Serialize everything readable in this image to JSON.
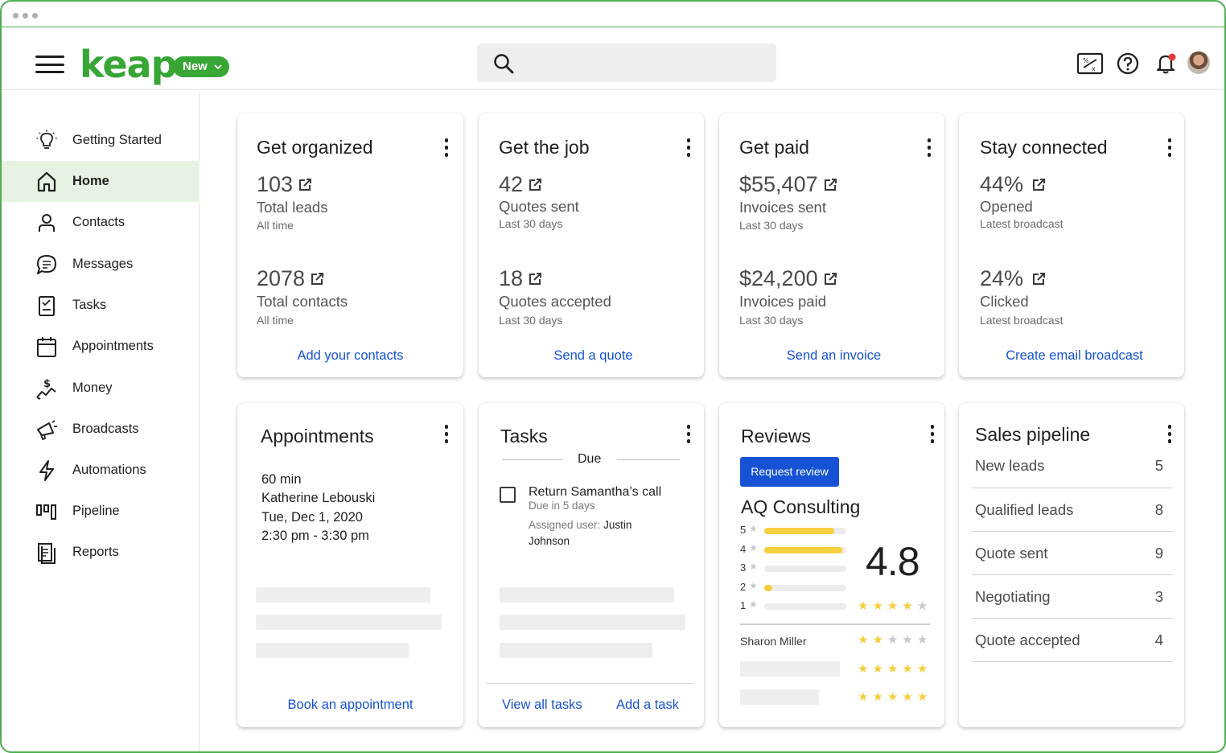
{
  "header": {
    "logo": "keap",
    "new_button": "New",
    "search_placeholder": ""
  },
  "sidebar": {
    "items": [
      {
        "label": "Getting Started",
        "icon": "lightbulb-icon"
      },
      {
        "label": "Home",
        "icon": "home-icon",
        "active": true
      },
      {
        "label": "Contacts",
        "icon": "person-icon"
      },
      {
        "label": "Messages",
        "icon": "chat-icon"
      },
      {
        "label": "Tasks",
        "icon": "checklist-icon"
      },
      {
        "label": "Appointments",
        "icon": "calendar-icon"
      },
      {
        "label": "Money",
        "icon": "money-icon"
      },
      {
        "label": "Broadcasts",
        "icon": "megaphone-icon"
      },
      {
        "label": "Automations",
        "icon": "lightning-icon"
      },
      {
        "label": "Pipeline",
        "icon": "pipeline-icon"
      },
      {
        "label": "Reports",
        "icon": "report-icon"
      }
    ]
  },
  "cards": {
    "organized": {
      "title": "Get organized",
      "m1_value": "103",
      "m1_label": "Total leads",
      "m1_sub": "All time",
      "m2_value": "2078",
      "m2_label": "Total contacts",
      "m2_sub": "All time",
      "link": "Add your contacts"
    },
    "job": {
      "title": "Get the job",
      "m1_value": "42",
      "m1_label": "Quotes sent",
      "m1_sub": "Last 30 days",
      "m2_value": "18",
      "m2_label": "Quotes accepted",
      "m2_sub": "Last 30 days",
      "link": "Send a quote"
    },
    "paid": {
      "title": "Get paid",
      "m1_value": "$55,407",
      "m1_label": "Invoices sent",
      "m1_sub": "Last 30 days",
      "m2_value": "$24,200",
      "m2_label": "Invoices paid",
      "m2_sub": "Last 30 days",
      "link": "Send an invoice"
    },
    "connected": {
      "title": "Stay connected",
      "m1_value": "44%",
      "m1_label": "Opened",
      "m1_sub": "Latest broadcast",
      "m2_value": "24%",
      "m2_label": "Clicked",
      "m2_sub": "Latest broadcast",
      "link": "Create email broadcast"
    },
    "appointments": {
      "title": "Appointments",
      "duration": "60 min",
      "name": "Katherine Lebouski",
      "date": "Tue, Dec 1, 2020",
      "time": "2:30 pm - 3:30 pm",
      "link": "Book an appointment"
    },
    "tasks": {
      "title": "Tasks",
      "section": "Due",
      "task_title": "Return Samantha’s call",
      "task_due": "Due in 5 days",
      "assigned_label": "Assigned user:",
      "assigned_user": "Justin Johnson",
      "link_view": "View all tasks",
      "link_add": "Add a task"
    },
    "reviews": {
      "title": "Reviews",
      "button": "Request review",
      "company": "AQ Consulting",
      "rating": "4.8",
      "rating_stars": 4,
      "distribution": [
        {
          "stars": "5",
          "fraction": 0.85
        },
        {
          "stars": "4",
          "fraction": 0.95
        },
        {
          "stars": "3",
          "fraction": 0.0
        },
        {
          "stars": "2",
          "fraction": 0.1
        },
        {
          "stars": "1",
          "fraction": 0.0
        }
      ],
      "reviewer": "Sharon Miller",
      "reviewer_stars": 2,
      "review_rows_stars": [
        5,
        5
      ]
    },
    "pipeline": {
      "title": "Sales pipeline",
      "stages": [
        {
          "name": "New leads",
          "count": "5"
        },
        {
          "name": "Qualified leads",
          "count": "8"
        },
        {
          "name": "Quote sent",
          "count": "9"
        },
        {
          "name": "Negotiating",
          "count": "3"
        },
        {
          "name": "Quote accepted",
          "count": "4"
        }
      ]
    }
  },
  "colors": {
    "brand": "#37a635",
    "link": "#1652d4",
    "star": "#f5cf3f",
    "button": "#1652d4"
  }
}
